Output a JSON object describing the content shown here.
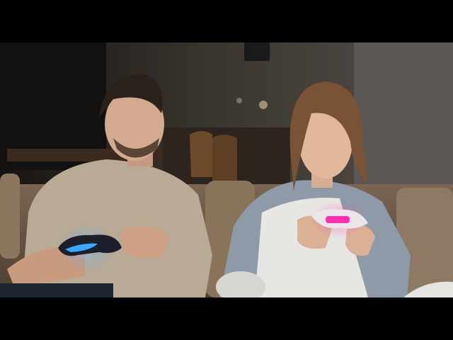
{
  "video_frame": {
    "scene": "living-room-gaming",
    "colors": {
      "background_dark": "#1d1a18",
      "sofa": "#6b5a48",
      "controller_left_light": "#3aa8ff",
      "controller_right_light": "#ff2fb4",
      "shirt_left": "#b9aa95",
      "sweater_right": "#8f9aa8"
    }
  }
}
